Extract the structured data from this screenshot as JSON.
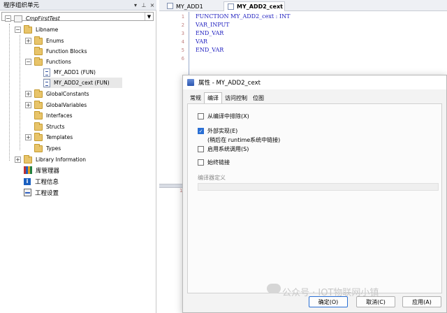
{
  "left_panel": {
    "title": "程序组织单元",
    "project": "CmpFirstTest",
    "tree": [
      {
        "label": "Libname"
      },
      {
        "label": "Enums"
      },
      {
        "label": "Function Blocks"
      },
      {
        "label": "Functions"
      },
      {
        "label": "MY_ADD1 (FUN)"
      },
      {
        "label": "MY_ADD2_cext (FUN)"
      },
      {
        "label": "GlobalConstants"
      },
      {
        "label": "GlobalVariables"
      },
      {
        "label": "Interfaces"
      },
      {
        "label": "Structs"
      },
      {
        "label": "Templates"
      },
      {
        "label": "Types"
      },
      {
        "label": "Library Information"
      },
      {
        "label": "库管理器"
      },
      {
        "label": "工程信息"
      },
      {
        "label": "工程设置"
      }
    ]
  },
  "editor": {
    "tabs": [
      {
        "label": "MY_ADD1"
      },
      {
        "label": "MY_ADD2_cext",
        "close": "x"
      }
    ],
    "lines": [
      {
        "num": "1",
        "text": "FUNCTION MY_ADD2_cext : INT"
      },
      {
        "num": "2",
        "text": "VAR_INPUT"
      },
      {
        "num": "3",
        "text": "END_VAR"
      },
      {
        "num": "4",
        "text": "VAR"
      },
      {
        "num": "5",
        "text": "END_VAR"
      },
      {
        "num": "6",
        "text": ""
      }
    ],
    "lower_line": "1"
  },
  "dialog": {
    "title": "属性 - MY_ADD2_cext",
    "tabs": [
      "常规",
      "编译",
      "访问控制",
      "位图"
    ],
    "options": {
      "exclude": "从编译中排除(X)",
      "external": "外部实现(E)",
      "external_note": "(稍后在 runtime系统中链接)",
      "system_call": "启用系统调用(S)",
      "always_link": "始终链接"
    },
    "compiler_defines_label": "编译器定义",
    "buttons": {
      "ok": "确定(O)",
      "cancel": "取消(C)",
      "apply": "应用(A)"
    }
  },
  "watermark": "公众号 · IOT物联网小镇"
}
